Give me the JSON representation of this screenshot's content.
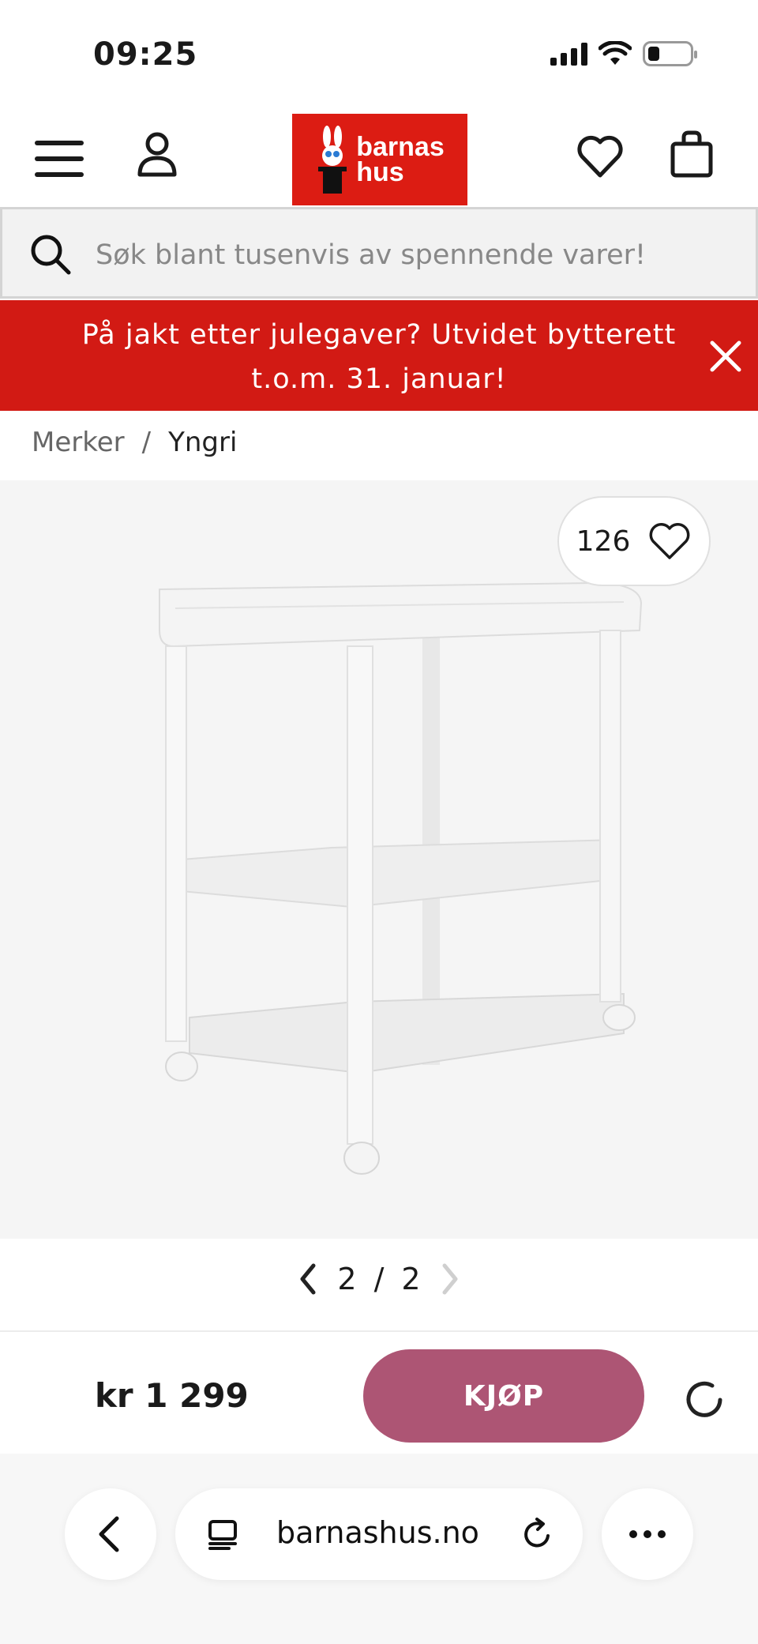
{
  "status_bar": {
    "time": "09:25"
  },
  "header": {
    "logo_text_line1": "barnas",
    "logo_text_line2": "hus",
    "brand_color": "#dc1c13"
  },
  "search": {
    "placeholder": "Søk blant tusenvis av spennende varer!"
  },
  "banner": {
    "text": "På jakt etter julegaver? Utvidet bytterett t.o.m. 31. januar!",
    "color": "#d21a14"
  },
  "breadcrumb": {
    "items": [
      "Merker",
      "Yngri"
    ],
    "separator": "/"
  },
  "product": {
    "favorites_count": "126"
  },
  "gallery": {
    "current": "2",
    "separator": "/",
    "total": "2"
  },
  "buy_bar": {
    "price": "kr 1 299",
    "buy_label": "KJØP",
    "buy_color": "#ad5574"
  },
  "browser": {
    "url": "barnashus.no"
  }
}
